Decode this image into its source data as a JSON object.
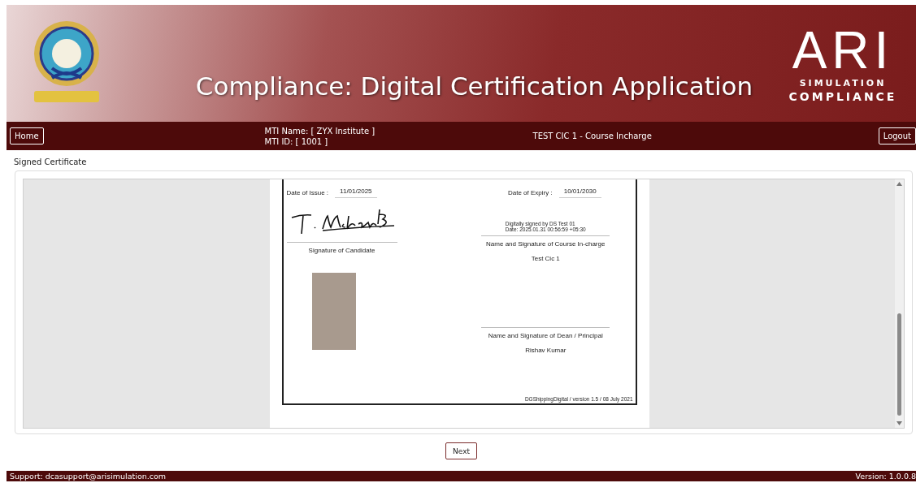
{
  "header": {
    "title": "Compliance: Digital Certification Application",
    "logo": {
      "letters": "ARI",
      "line1": "SIMULATION",
      "line2": "COMPLIANCE"
    }
  },
  "nav": {
    "home_button": "Home",
    "mti_name": "MTI Name: [ ZYX Institute ]",
    "mti_id": "MTI ID: [ 1001 ]",
    "user": "TEST CIC 1 - Course Incharge",
    "logout_button": "Logout"
  },
  "section_title": "Signed Certificate",
  "certificate": {
    "date_of_issue": {
      "label": "Date of Issue :",
      "value": "11/01/2025"
    },
    "date_of_expiry": {
      "label": "Date of Expiry :",
      "value": "10/01/2030"
    },
    "digital_signature": [
      "Digitally signed by DS Test 01",
      "Date: 2025.01.31 00:56:59 +05:30"
    ],
    "candidate_caption": "Signature of Candidate",
    "course_incharge": {
      "caption": "Name and Signature of Course In-charge",
      "name": "Test Cic 1"
    },
    "dean": {
      "caption": "Name and Signature of Dean / Principal",
      "name": "Rishav Kumar"
    },
    "footer_note": "DGShippingDigital / version 1.5 / 08 July 2021"
  },
  "next_button": "Next",
  "footer": {
    "support": "Support: dcasupport@arisimulation.com",
    "version": "Version: 1.0.0.8"
  }
}
